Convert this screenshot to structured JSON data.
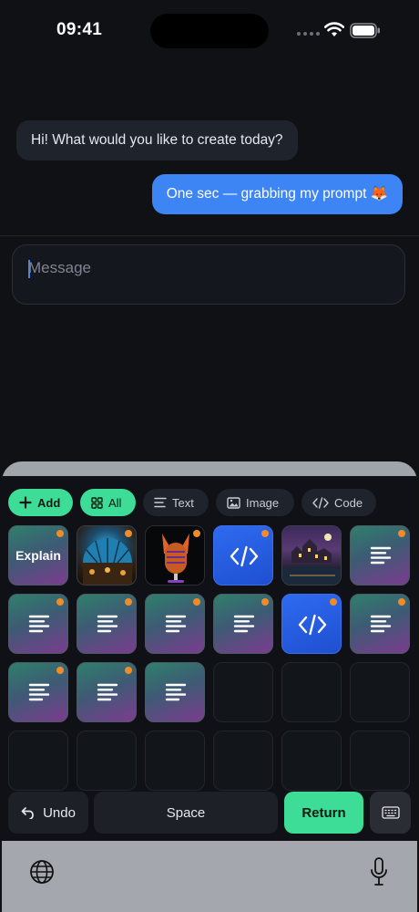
{
  "status": {
    "time": "09:41"
  },
  "chat": {
    "messages": [
      {
        "from": "assistant",
        "text": "Hi! What would you like to create today?"
      },
      {
        "from": "user",
        "text": "One sec — grabbing my prompt 🦊"
      }
    ],
    "input": {
      "placeholder": "Message",
      "value": ""
    }
  },
  "keyboard": {
    "filters": [
      {
        "label": "Add",
        "icon": "plus-icon",
        "selected": true
      },
      {
        "label": "All",
        "icon": "grid-icon",
        "selected": true
      },
      {
        "label": "Text",
        "icon": "text-lines-icon",
        "selected": false
      },
      {
        "label": "Image",
        "icon": "image-icon",
        "selected": false
      },
      {
        "label": "Code",
        "icon": "code-icon",
        "selected": false
      }
    ],
    "tiles": [
      {
        "kind": "text",
        "label": "Explain",
        "badge": true
      },
      {
        "kind": "image",
        "icon": "dome-library-thumbnail",
        "badge": true
      },
      {
        "kind": "image",
        "icon": "fox-microphone-thumbnail",
        "badge": true
      },
      {
        "kind": "code",
        "icon": "code-icon",
        "badge": true
      },
      {
        "kind": "image",
        "icon": "night-castle-thumbnail",
        "badge": false
      },
      {
        "kind": "text",
        "icon": "text-lines-icon",
        "badge": true
      },
      {
        "kind": "text",
        "icon": "text-lines-icon",
        "badge": true
      },
      {
        "kind": "text",
        "icon": "text-lines-icon",
        "badge": true
      },
      {
        "kind": "text",
        "icon": "text-lines-icon",
        "badge": true
      },
      {
        "kind": "text",
        "icon": "text-lines-icon",
        "badge": true
      },
      {
        "kind": "code",
        "icon": "code-icon",
        "badge": true
      },
      {
        "kind": "text",
        "icon": "text-lines-icon",
        "badge": true
      },
      {
        "kind": "text",
        "icon": "text-lines-icon",
        "badge": true
      },
      {
        "kind": "text",
        "icon": "text-lines-icon",
        "badge": true
      },
      {
        "kind": "text",
        "icon": "text-lines-icon",
        "badge": false
      }
    ],
    "keys": {
      "undo": "Undo",
      "space": "Space",
      "return": "Return"
    },
    "colors": {
      "accent_green": "#3ddc97",
      "badge_orange": "#f08b2c",
      "bubble_blue": "#3d84f5"
    }
  }
}
